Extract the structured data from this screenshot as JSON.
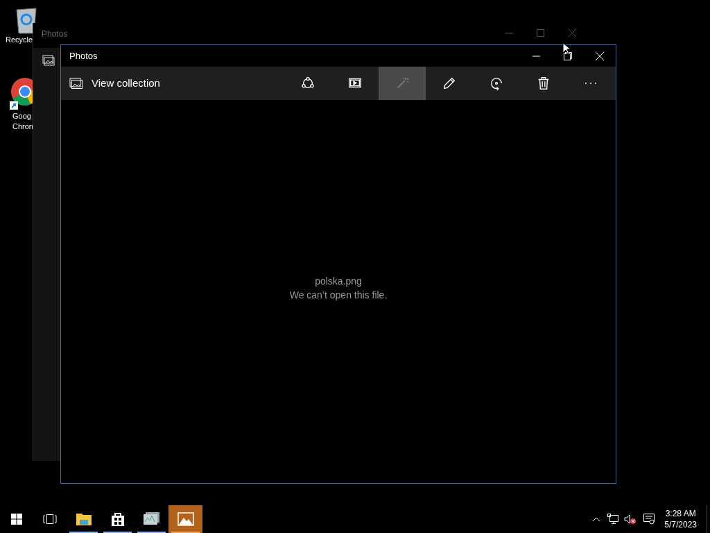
{
  "desktop_icons": [
    {
      "kind": "recycle-bin",
      "lines": [
        "Recycle"
      ]
    },
    {
      "kind": "browser",
      "lines": [
        "Goog",
        "Chron"
      ]
    }
  ],
  "back_window": {
    "title": "Photos"
  },
  "window": {
    "title": "Photos",
    "view_collection": "View collection",
    "tools": [
      {
        "kind": "share",
        "highlighted": false
      },
      {
        "kind": "slideshow",
        "highlighted": false
      },
      {
        "kind": "enhance",
        "highlighted": true
      },
      {
        "kind": "edit",
        "highlighted": false
      },
      {
        "kind": "rotate",
        "highlighted": false
      },
      {
        "kind": "delete",
        "highlighted": false
      },
      {
        "kind": "more",
        "highlighted": false
      }
    ],
    "file_name": "polska.png",
    "message": "We can’t open this file."
  },
  "taskbar": {
    "apps": [
      {
        "kind": "explorer",
        "running": true,
        "active": false
      },
      {
        "kind": "store",
        "running": true,
        "active": false
      },
      {
        "kind": "monitor",
        "running": true,
        "active": false
      },
      {
        "kind": "photos",
        "running": true,
        "active": true
      }
    ],
    "time": "3:28 AM",
    "date": "5/7/2023"
  }
}
